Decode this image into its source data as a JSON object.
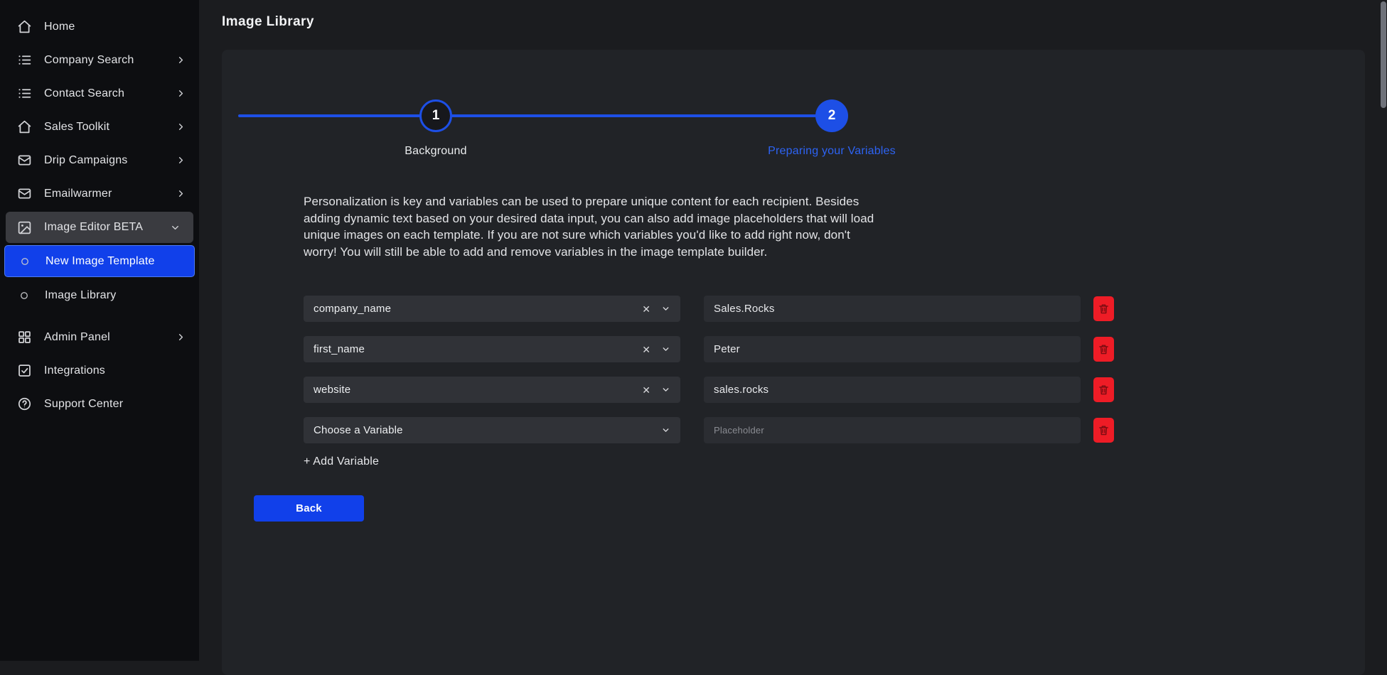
{
  "sidebar": {
    "items": [
      {
        "label": "Home",
        "icon": "home-icon"
      },
      {
        "label": "Company Search",
        "icon": "list-icon",
        "chevron": "right"
      },
      {
        "label": "Contact Search",
        "icon": "list-icon",
        "chevron": "right"
      },
      {
        "label": "Sales Toolkit",
        "icon": "home-icon",
        "chevron": "right"
      },
      {
        "label": "Drip Campaigns",
        "icon": "mail-icon",
        "chevron": "right"
      },
      {
        "label": "Emailwarmer",
        "icon": "mail-icon",
        "chevron": "right"
      },
      {
        "label": "Image Editor BETA",
        "icon": "image-icon",
        "chevron": "down",
        "expanded": true
      },
      {
        "label": "New Image Template",
        "icon": "radio-icon",
        "sub": true,
        "selected": true
      },
      {
        "label": "Image Library",
        "icon": "radio-icon",
        "sub": true
      },
      {
        "label": "Admin Panel",
        "icon": "grid-icon",
        "chevron": "right"
      },
      {
        "label": "Integrations",
        "icon": "check-square-icon"
      },
      {
        "label": "Support Center",
        "icon": "help-circle-icon"
      }
    ]
  },
  "header": {
    "title": "Image Library"
  },
  "stepper": {
    "steps": [
      {
        "number": "1",
        "label": "Background",
        "state": "completed"
      },
      {
        "number": "2",
        "label": "Preparing your Variables",
        "state": "active"
      }
    ]
  },
  "intro": "Personalization is key and variables can be used to prepare unique content for each recipient. Besides adding dynamic text based on your desired data input, you can also add image placeholders that will load unique images on each template. If you are not sure which variables you'd like to add right now, don't worry! You will still be able to add and remove variables in the image template builder.",
  "variables": {
    "rows": [
      {
        "variable": "company_name",
        "value": "Sales.Rocks",
        "clearable": true
      },
      {
        "variable": "first_name",
        "value": "Peter",
        "clearable": true
      },
      {
        "variable": "website",
        "value": "sales.rocks",
        "clearable": true
      },
      {
        "variable": "Choose a Variable",
        "value": "",
        "placeholder": "Placeholder",
        "clearable": false
      }
    ],
    "add_label": "+ Add Variable"
  },
  "actions": {
    "back_label": "Back"
  },
  "colors": {
    "accent": "#1d4fe6",
    "active_item": "#1140ea",
    "danger": "#ee1c26",
    "sidebar_bg": "#0d0e11",
    "card_bg": "#212327"
  }
}
